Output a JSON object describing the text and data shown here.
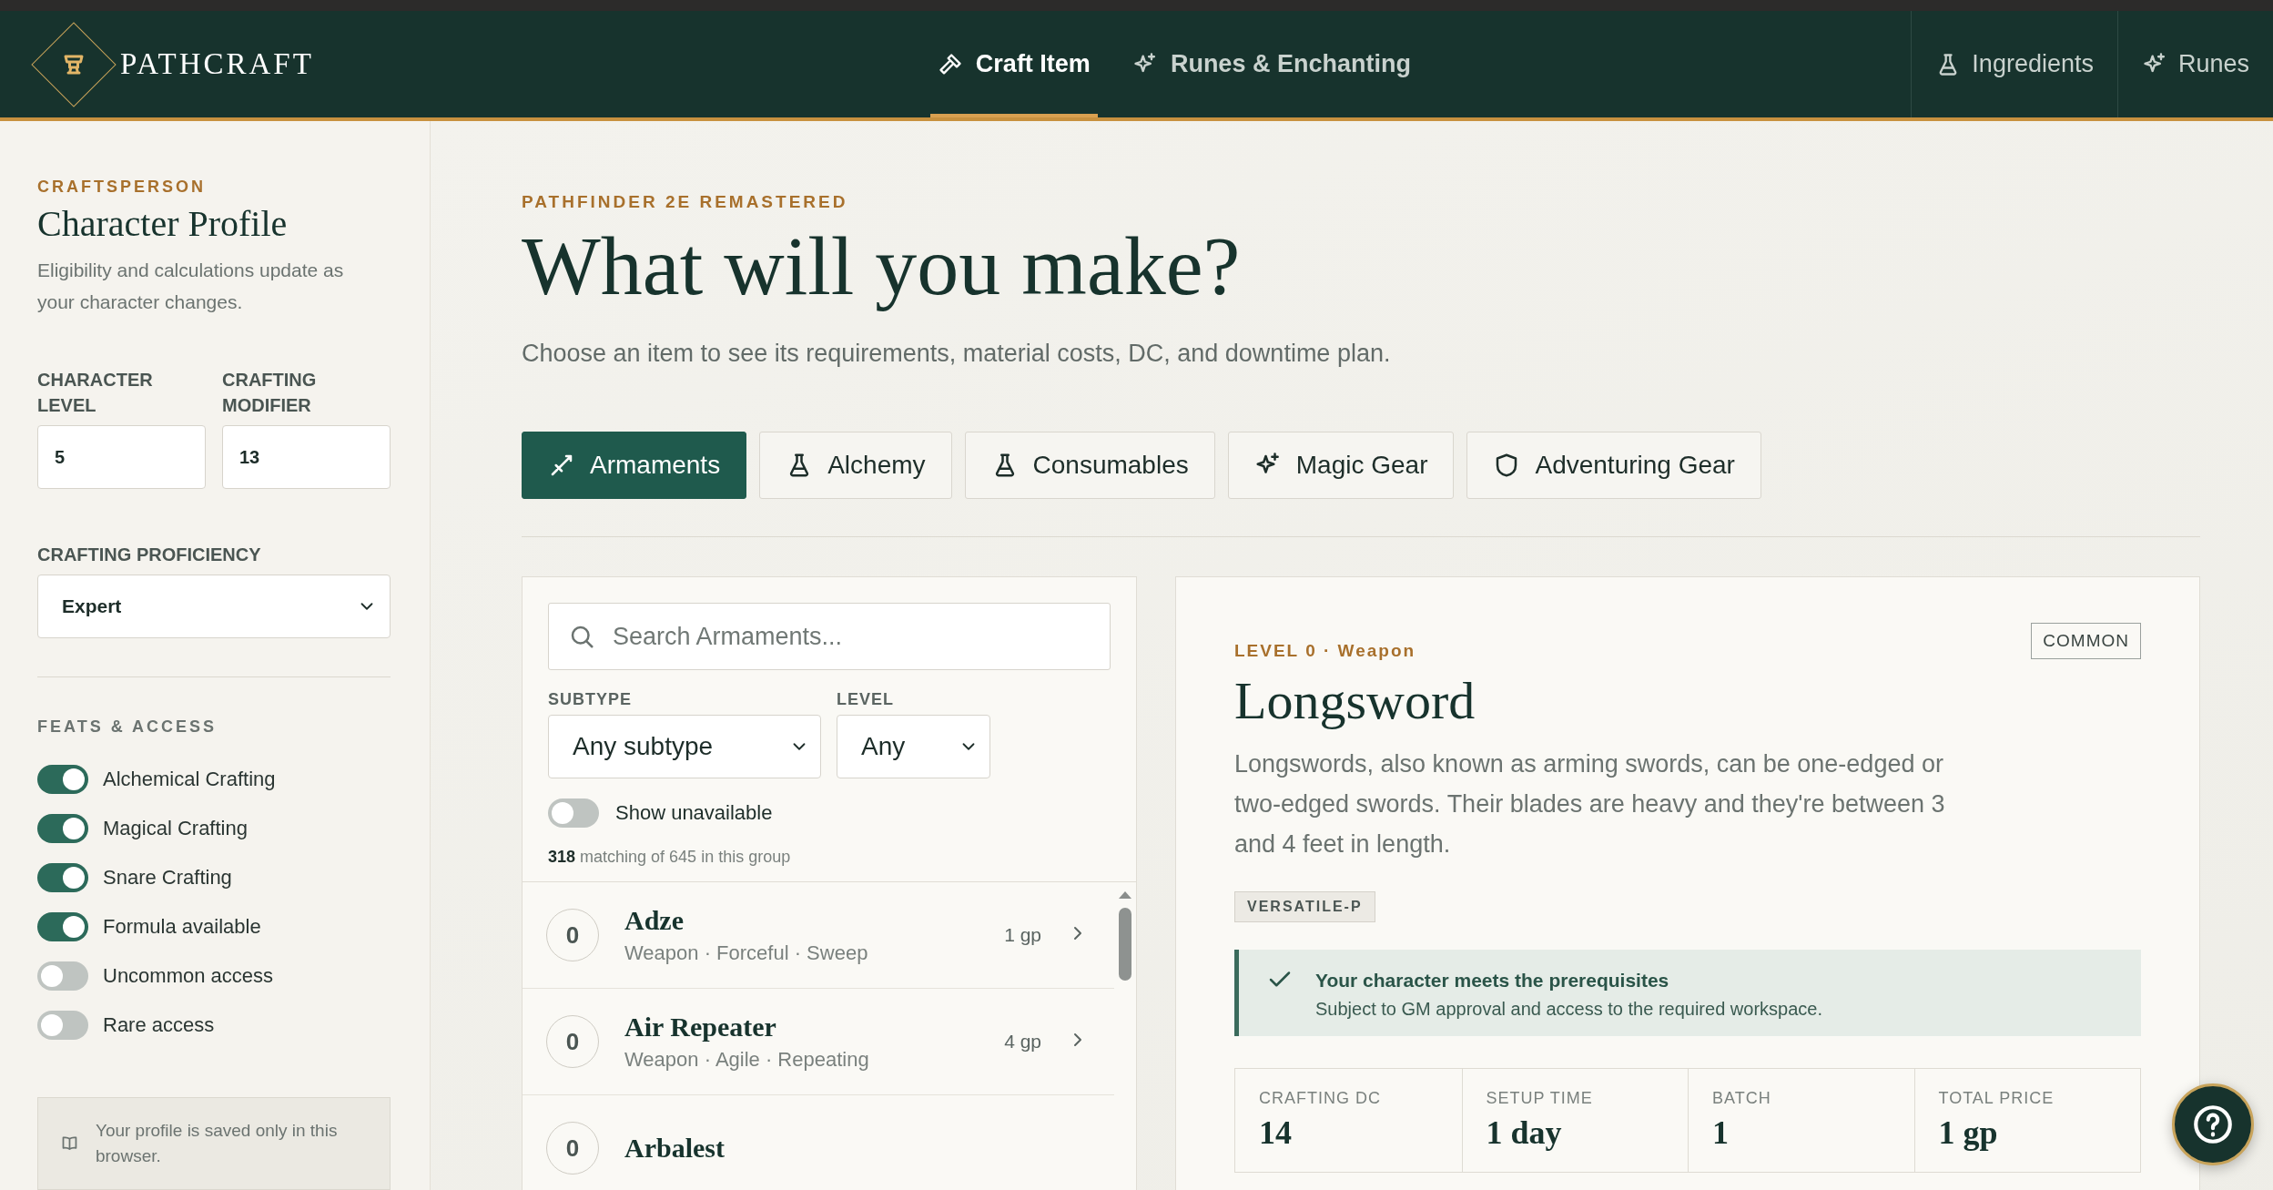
{
  "brand": {
    "name": "PATHCRAFT"
  },
  "nav": [
    {
      "label": "Craft Item",
      "selected": true
    },
    {
      "label": "Runes & Enchanting",
      "selected": false
    }
  ],
  "nav_right": [
    {
      "label": "Ingredients"
    },
    {
      "label": "Runes"
    }
  ],
  "sidebar": {
    "kicker": "CRAFTSPERSON",
    "title": "Character Profile",
    "description": "Eligibility and calculations update as your character changes.",
    "fields": [
      {
        "label": "CHARACTER LEVEL",
        "value": "5"
      },
      {
        "label": "CRAFTING MODIFIER",
        "value": "13"
      }
    ],
    "proficiency": {
      "label": "CRAFTING PROFICIENCY",
      "value": "Expert"
    },
    "feats_heading": "FEATS & ACCESS",
    "toggles": [
      {
        "label": "Alchemical Crafting",
        "on": true
      },
      {
        "label": "Magical Crafting",
        "on": true
      },
      {
        "label": "Snare Crafting",
        "on": true
      },
      {
        "label": "Formula available",
        "on": true
      },
      {
        "label": "Uncommon access",
        "on": false
      },
      {
        "label": "Rare access",
        "on": false
      }
    ],
    "note": "Your profile is saved only in this browser."
  },
  "page": {
    "kicker": "PATHFINDER 2E REMASTERED",
    "title": "What will you make?",
    "subtitle": "Choose an item to see its requirements, material costs, DC, and downtime plan."
  },
  "categories": [
    {
      "label": "Armaments",
      "selected": true
    },
    {
      "label": "Alchemy",
      "selected": false
    },
    {
      "label": "Consumables",
      "selected": false
    },
    {
      "label": "Magic Gear",
      "selected": false
    },
    {
      "label": "Adventuring Gear",
      "selected": false
    }
  ],
  "list": {
    "search": {
      "placeholder": "Search Armaments..."
    },
    "filters": [
      {
        "label": "SUBTYPE",
        "value": "Any subtype"
      },
      {
        "label": "LEVEL",
        "value": "Any"
      }
    ],
    "show_unavailable": {
      "label": "Show unavailable",
      "on": false
    },
    "count": "**318** matching of 645 in this group",
    "items": [
      {
        "item_level": "0",
        "name": "Adze",
        "traits": "Weapon · Forceful · Sweep",
        "price": "1 gp"
      },
      {
        "item_level": "0",
        "name": "Air Repeater",
        "traits": "Weapon · Agile · Repeating",
        "price": "4 gp"
      },
      {
        "item_level": "0",
        "name": "Arbalest"
      }
    ]
  },
  "detail": {
    "kicker": "LEVEL 0 · Weapon",
    "rarity": "COMMON",
    "title": "Longsword",
    "description": "Longswords, also known as arming swords, can be one-edged or two-edged swords. Their blades are heavy and they're between 3 and 4 feet in length.",
    "traits": [
      "VERSATILE-P"
    ],
    "prereq": {
      "met": true,
      "title": "Your character meets the prerequisites",
      "text": "Subject to GM approval and access to the required workspace."
    },
    "stats": [
      {
        "label": "CRAFTING DC",
        "value": "14"
      },
      {
        "label": "SETUP TIME",
        "value": "1 day"
      },
      {
        "label": "BATCH",
        "value": "1"
      },
      {
        "label": "TOTAL PRICE",
        "value": "1 gp"
      }
    ]
  }
}
